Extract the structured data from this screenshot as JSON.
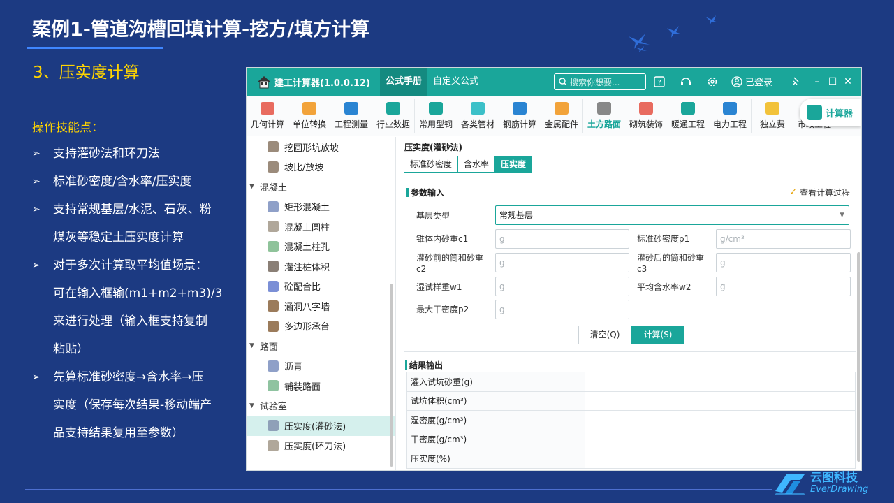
{
  "slide": {
    "title": "案例1-管道沟槽回填计算-挖方/填方计算",
    "section": "3、压实度计算",
    "skills_heading": "操作技能点：",
    "bullets": [
      {
        "arrow": "➢",
        "lines": [
          "支持灌砂法和环刀法"
        ]
      },
      {
        "arrow": "➢",
        "lines": [
          "标准砂密度/含水率/压实度"
        ]
      },
      {
        "arrow": "➢",
        "lines": [
          "支持常规基层/水泥、石灰、粉",
          "煤灰等稳定土压实度计算"
        ]
      },
      {
        "arrow": "➢",
        "lines": [
          "对于多次计算取平均值场景：",
          "可在输入框输(m1+m2+m3)/3",
          "来进行处理（输入框支持复制",
          "粘贴）"
        ]
      },
      {
        "arrow": "➢",
        "lines": [
          "先算标准砂密度→含水率→压",
          "实度（保存每次结果-移动端产",
          "品支持结果复用至参数）"
        ]
      }
    ],
    "logo_cn": "云图科技",
    "logo_en": "EverDrawing"
  },
  "app": {
    "name": "建工计算器(1.0.0.12)",
    "nav_tabs": [
      "公式手册",
      "自定义公式"
    ],
    "search_placeholder": "搜索你想要...",
    "login": "已登录",
    "toolbar": [
      {
        "label": "几何计算",
        "color": "#e86b5f"
      },
      {
        "label": "单位转换",
        "color": "#f2a33a"
      },
      {
        "label": "工程测量",
        "color": "#2a84d2"
      },
      {
        "label": "行业数据",
        "color": "#1aa69a"
      },
      {
        "label": "常用型钢",
        "color": "#1aa69a"
      },
      {
        "label": "各类管材",
        "color": "#3cc0c8"
      },
      {
        "label": "钢筋计算",
        "color": "#2a84d2"
      },
      {
        "label": "金属配件",
        "color": "#f2a33a"
      },
      {
        "label": "土方路面",
        "color": "#888888"
      },
      {
        "label": "砌筑装饰",
        "color": "#e86b5f"
      },
      {
        "label": "暖通工程",
        "color": "#1aa69a"
      },
      {
        "label": "电力工程",
        "color": "#2a84d2"
      },
      {
        "label": "独立费",
        "color": "#f2c23a"
      },
      {
        "label": "市政工程",
        "color": "#2a84d2"
      }
    ],
    "active_tool": "土方路面",
    "calc_button": "计算器",
    "sidebar": [
      {
        "type": "item",
        "label": "挖圆形坑放坡",
        "icon": "circle-pit-icon",
        "color": "#9b8b7b"
      },
      {
        "type": "item",
        "label": "坡比/放坡",
        "icon": "slope-icon",
        "color": "#9b8b7b"
      },
      {
        "type": "cat",
        "label": "混凝土"
      },
      {
        "type": "item",
        "label": "矩形混凝土",
        "icon": "rect-concrete-icon",
        "color": "#8fa0c8"
      },
      {
        "type": "item",
        "label": "混凝土圆柱",
        "icon": "cylinder-icon",
        "color": "#b0a79a"
      },
      {
        "type": "item",
        "label": "混凝土柱孔",
        "icon": "column-hole-icon",
        "color": "#8fc39a"
      },
      {
        "type": "item",
        "label": "灌注桩体积",
        "icon": "pile-icon",
        "color": "#8a7f76"
      },
      {
        "type": "item",
        "label": "砼配合比",
        "icon": "mix-ratio-icon",
        "color": "#7b8fd6"
      },
      {
        "type": "item",
        "label": "涵洞八字墙",
        "icon": "culvert-vip-icon",
        "color": "#9b7b5b"
      },
      {
        "type": "item",
        "label": "多边形承台",
        "icon": "polygon-cap-vip-icon",
        "color": "#9b7b5b"
      },
      {
        "type": "cat",
        "label": "路面"
      },
      {
        "type": "item",
        "label": "沥青",
        "icon": "asphalt-icon",
        "color": "#8fa0c8"
      },
      {
        "type": "item",
        "label": "铺装路面",
        "icon": "paving-icon",
        "color": "#8fc3a0"
      },
      {
        "type": "cat",
        "label": "试验室"
      },
      {
        "type": "item",
        "label": "压实度(灌砂法)",
        "icon": "compaction-sand-icon",
        "color": "#8fa0b8",
        "active": true
      },
      {
        "type": "item",
        "label": "压实度(环刀法)",
        "icon": "compaction-ring-icon",
        "color": "#b0a79a"
      }
    ],
    "main": {
      "title": "压实度(灌砂法)",
      "subtabs": [
        "标准砂密度",
        "含水率",
        "压实度"
      ],
      "active_subtab": "压实度",
      "params_heading": "参数输入",
      "view_process": "查看计算过程",
      "base_type_label": "基层类型",
      "base_type_value": "常规基层",
      "fields": {
        "c1_label": "锥体内砂重c1",
        "c1_unit": "g",
        "p1_label": "标准砂密度p1",
        "p1_unit": "g/cm³",
        "c2_label_1": "灌砂前的筒和砂重",
        "c2_label_2": "c2",
        "c2_unit": "g",
        "c3_label_1": "灌砂后的筒和砂重",
        "c3_label_2": "c3",
        "c3_unit": "g",
        "w1_label": "湿试样重w1",
        "w1_unit": "g",
        "w2_label": "平均含水率w2",
        "w2_unit": "g",
        "p2_label": "最大干密度p2",
        "p2_unit": "g"
      },
      "clear_button": "清空(Q)",
      "calc_button": "计算(S)",
      "results_heading": "结果输出",
      "results": [
        {
          "key": "灌入试坑砂重(g)",
          "value": ""
        },
        {
          "key": "试坑体积(cm³)",
          "value": ""
        },
        {
          "key": "湿密度(g/cm³)",
          "value": ""
        },
        {
          "key": "干密度(g/cm³)",
          "value": ""
        },
        {
          "key": "压实度(%)",
          "value": ""
        }
      ]
    }
  }
}
